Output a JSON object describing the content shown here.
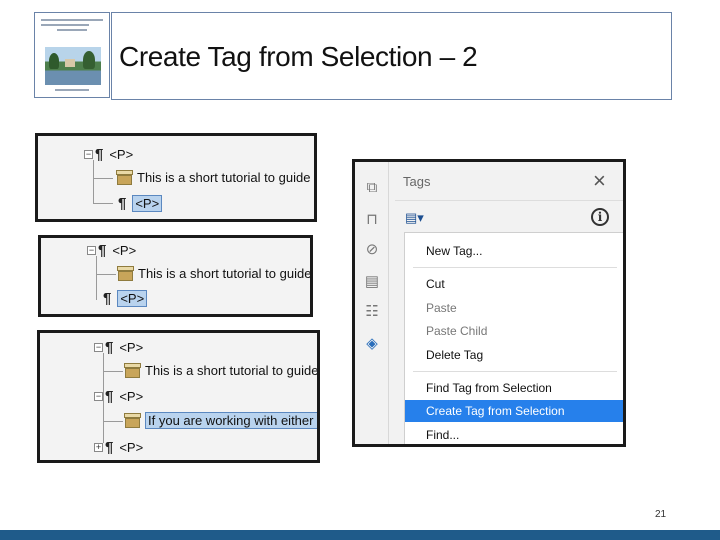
{
  "slide": {
    "title": "Create Tag from Selection – 2",
    "page_number": "21"
  },
  "panel1": {
    "rows": [
      "<P>",
      "This is a short tutorial to guide",
      "<P>"
    ]
  },
  "panel2": {
    "rows": [
      "<P>",
      "This is a short tutorial to guide",
      "<P>"
    ]
  },
  "panel3": {
    "rows": [
      "<P>",
      "This is a short tutorial to guide",
      "<P>",
      "If you are working with either f",
      "<P>"
    ]
  },
  "tags_panel": {
    "title": "Tags",
    "close_icon": "close-icon",
    "options_icon": "tag-options-icon",
    "info_icon": "info-icon",
    "rail_icons": [
      "pages-icon",
      "bookmarks-icon",
      "attachments-icon",
      "document-icon",
      "order-icon",
      "tags-icon"
    ],
    "menu": {
      "new_tag": "New Tag...",
      "cut": "Cut",
      "paste": "Paste",
      "paste_child": "Paste Child",
      "delete_tag": "Delete Tag",
      "find_tag": "Find Tag from Selection",
      "create_tag": "Create Tag from Selection",
      "find": "Find..."
    },
    "highlight_color": "#2680eb"
  },
  "colors": {
    "footer": "#1f5b8a",
    "selection": "#b9d3ee"
  }
}
